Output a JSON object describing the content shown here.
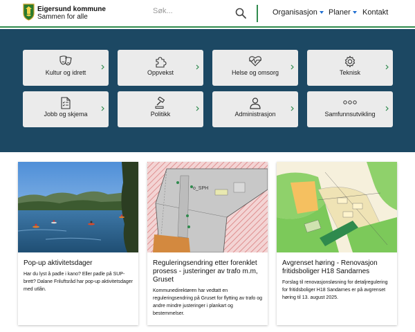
{
  "header": {
    "brand_name": "Eigersund kommune",
    "brand_slogan": "Sammen for alle",
    "search_placeholder": "Søk...",
    "nav": [
      {
        "label": "Organisasjon",
        "has_dropdown": true
      },
      {
        "label": "Planer",
        "has_dropdown": true
      },
      {
        "label": "Kontakt",
        "has_dropdown": false
      }
    ]
  },
  "colors": {
    "accent_green": "#2f8a4d",
    "hero_blue": "#1c4863",
    "tile_bg": "#ebebeb",
    "chevron_green": "#2f8a4d",
    "dropdown_blue": "#1f6fd1"
  },
  "tiles": [
    {
      "label": "Kultur og idrett",
      "icon": "theater-masks-icon"
    },
    {
      "label": "Oppvekst",
      "icon": "puzzle-icon"
    },
    {
      "label": "Helse og omsorg",
      "icon": "heart-pulse-icon"
    },
    {
      "label": "Teknisk",
      "icon": "gear-icon"
    },
    {
      "label": "Jobb og skjema",
      "icon": "document-checklist-icon"
    },
    {
      "label": "Politikk",
      "icon": "gavel-icon"
    },
    {
      "label": "Administrasjon",
      "icon": "person-icon"
    },
    {
      "label": "Samfunnsutvikling",
      "icon": "three-dots-icon"
    }
  ],
  "cards": [
    {
      "title": "Pop-up aktivitetsdager",
      "text": "Har du lyst å padle i kano? Eller padle på SUP-brett? Dalane Friluftsråd har pop-up aktivitetsdager med utlån.",
      "image": "lake-canoe-photo"
    },
    {
      "title": "Reguleringsendring etter forenklet prosess - justeringer av trafo m.m, Gruset",
      "text": "Kommunedirektøren har vedtatt en reguleringsendring på Gruset for flytting av trafo og andre mindre justeringer i plankart og bestemmelser.",
      "image": "zoning-map-gruset",
      "map_label": "o_SPH"
    },
    {
      "title": "Avgrenset høring - Renovasjon fritidsboliger H18 Sandarnes",
      "text": "Forslag til renovasjonsløsning for detaljregulering for fritidsboliger H18 Sandarnes er på avgrenset høring til 13. august 2025.",
      "image": "zoning-map-sandarnes"
    }
  ]
}
